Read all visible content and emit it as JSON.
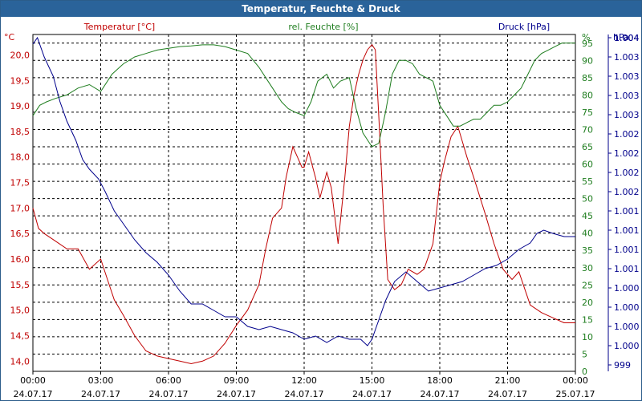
{
  "window": {
    "title": "Temperatur, Feuchte & Druck"
  },
  "colors": {
    "temperature": "#c00000",
    "humidity": "#1e7d1e",
    "pressure": "#00008b",
    "grid": "#000000",
    "title_bar": "#2a639a"
  },
  "chart_data": {
    "type": "line",
    "title": "Temperatur, Feuchte & Druck",
    "grid": true,
    "x": {
      "ticks": [
        {
          "time": "00:00",
          "date": "24.07.17"
        },
        {
          "time": "03:00",
          "date": "24.07.17"
        },
        {
          "time": "06:00",
          "date": "24.07.17"
        },
        {
          "time": "09:00",
          "date": "24.07.17"
        },
        {
          "time": "12:00",
          "date": "24.07.17"
        },
        {
          "time": "15:00",
          "date": "24.07.17"
        },
        {
          "time": "18:00",
          "date": "24.07.17"
        },
        {
          "time": "21:00",
          "date": "24.07.17"
        },
        {
          "time": "00:00",
          "date": "25.07.17"
        }
      ],
      "range_hours": [
        0,
        24
      ]
    },
    "axes": {
      "temperature": {
        "label": "Temperatur [°C]",
        "unit": "°C",
        "ylim": [
          13.8,
          20.4
        ],
        "ticks": [
          "14,0",
          "14,5",
          "15,0",
          "15,5",
          "16,0",
          "16,5",
          "17,0",
          "17,5",
          "18,0",
          "18,5",
          "19,0",
          "19,5",
          "20,0"
        ],
        "tick_values": [
          14.0,
          14.5,
          15.0,
          15.5,
          16.0,
          16.5,
          17.0,
          17.5,
          18.0,
          18.5,
          19.0,
          19.5,
          20.0
        ]
      },
      "humidity": {
        "label": "rel. Feuchte [%]",
        "unit": "%",
        "ylim": [
          0,
          97.5
        ],
        "ticks": [
          "0",
          "5",
          "10",
          "15",
          "20",
          "25",
          "30",
          "35",
          "40",
          "45",
          "50",
          "55",
          "60",
          "65",
          "70",
          "75",
          "80",
          "85",
          "90",
          "95"
        ],
        "tick_values": [
          0,
          5,
          10,
          15,
          20,
          25,
          30,
          35,
          40,
          45,
          50,
          55,
          60,
          65,
          70,
          75,
          80,
          85,
          90,
          95
        ]
      },
      "pressure": {
        "label": "Druck [hPa]",
        "unit": "hPa",
        "ylim": [
          998.9,
          1004.15
        ],
        "ticks": [
          "999",
          "1.000",
          "1.000",
          "1.000",
          "1.000",
          "1.001",
          "1.001",
          "1.001",
          "1.001",
          "1.002",
          "1.002",
          "1.002",
          "1.002",
          "1.003",
          "1.003",
          "1.003",
          "1.003",
          "1.004",
          "1.004"
        ],
        "tick_values": [
          999.0,
          999.3,
          999.6,
          999.9,
          1000.2,
          1000.5,
          1000.8,
          1001.1,
          1001.4,
          1001.7,
          1002.0,
          1002.3,
          1002.6,
          1002.9,
          1003.2,
          1003.5,
          1003.8,
          1004.1,
          1004.1
        ]
      }
    },
    "series": [
      {
        "name": "Temperatur [°C]",
        "axis": "temperature",
        "x": [
          0,
          0.25,
          0.5,
          1,
          1.5,
          2,
          2.5,
          3,
          3.3,
          3.6,
          4,
          4.5,
          5,
          5.5,
          6,
          6.5,
          7,
          7.5,
          8,
          8.5,
          9,
          9.5,
          10,
          10.3,
          10.6,
          11,
          11.2,
          11.5,
          11.7,
          11.9,
          12,
          12.2,
          12.5,
          12.7,
          13,
          13.2,
          13.5,
          13.8,
          14,
          14.2,
          14.4,
          14.6,
          14.8,
          15,
          15.15,
          15.3,
          15.5,
          15.7,
          16,
          16.3,
          16.6,
          17,
          17.3,
          17.7,
          18,
          18.2,
          18.5,
          18.8,
          19,
          19.2,
          19.5,
          20,
          20.4,
          20.8,
          21.2,
          21.5,
          22,
          22.5,
          23,
          23.5,
          24
        ],
        "values": [
          17.0,
          16.6,
          16.5,
          16.35,
          16.2,
          16.2,
          15.8,
          16.0,
          15.6,
          15.2,
          14.9,
          14.5,
          14.2,
          14.1,
          14.05,
          14.0,
          13.95,
          14.0,
          14.1,
          14.35,
          14.7,
          15.0,
          15.5,
          16.2,
          16.8,
          17.0,
          17.6,
          18.2,
          18.0,
          17.8,
          17.8,
          18.1,
          17.6,
          17.2,
          17.7,
          17.4,
          16.3,
          17.6,
          18.6,
          19.2,
          19.6,
          19.9,
          20.1,
          20.2,
          20.1,
          18.8,
          17.0,
          15.6,
          15.4,
          15.5,
          15.8,
          15.7,
          15.8,
          16.3,
          17.5,
          17.9,
          18.4,
          18.6,
          18.3,
          18.0,
          17.6,
          16.9,
          16.3,
          15.8,
          15.6,
          15.75,
          15.1,
          14.95,
          14.85,
          14.75,
          14.75
        ]
      },
      {
        "name": "rel. Feuchte [%]",
        "axis": "humidity",
        "x": [
          0,
          0.3,
          0.6,
          1,
          1.5,
          2,
          2.5,
          3,
          3.5,
          4,
          4.5,
          5,
          5.5,
          6,
          6.5,
          7,
          7.5,
          8,
          8.5,
          9,
          9.5,
          10,
          10.3,
          10.6,
          11,
          11.3,
          11.6,
          12,
          12.3,
          12.6,
          13,
          13.3,
          13.6,
          14,
          14.3,
          14.6,
          15,
          15.3,
          15.6,
          15.9,
          16.2,
          16.5,
          16.8,
          17.1,
          17.4,
          17.7,
          18,
          18.3,
          18.6,
          18.9,
          19.2,
          19.5,
          19.8,
          20.1,
          20.4,
          20.7,
          21,
          21.3,
          21.6,
          21.9,
          22.2,
          22.5,
          22.8,
          23.1,
          23.4,
          23.7,
          24
        ],
        "values": [
          74,
          77,
          78,
          79,
          80,
          82,
          83,
          81,
          86,
          89,
          91,
          92,
          93,
          93.5,
          94,
          94.2,
          94.5,
          94.5,
          94,
          93,
          92,
          88,
          85,
          82,
          78,
          76,
          75,
          74,
          78,
          84,
          86,
          82,
          84,
          85,
          76,
          69,
          65,
          66,
          75,
          86,
          90,
          90,
          89,
          86,
          85,
          84,
          77,
          74,
          71,
          71,
          72,
          73,
          73,
          75,
          77,
          77,
          78,
          80,
          82,
          86,
          90,
          92,
          93,
          94,
          95,
          95,
          95
        ]
      },
      {
        "name": "Druck [hPa]",
        "axis": "pressure",
        "x": [
          0,
          0.2,
          0.5,
          0.9,
          1.2,
          1.5,
          1.9,
          2.2,
          2.5,
          2.9,
          3.2,
          3.6,
          4,
          4.5,
          5,
          5.5,
          6,
          6.5,
          7,
          7.5,
          8,
          8.5,
          9,
          9.5,
          10,
          10.5,
          11,
          11.5,
          12,
          12.5,
          13,
          13.5,
          14,
          14.5,
          14.8,
          15,
          15.3,
          15.6,
          16,
          16.5,
          17,
          17.5,
          18,
          18.5,
          19,
          19.5,
          20,
          20.5,
          21,
          21.5,
          22,
          22.3,
          22.6,
          23,
          23.5,
          24
        ],
        "values": [
          1004.0,
          1004.1,
          1003.8,
          1003.5,
          1003.1,
          1002.8,
          1002.5,
          1002.2,
          1002.05,
          1001.9,
          1001.7,
          1001.4,
          1001.2,
          1000.95,
          1000.75,
          1000.6,
          1000.4,
          1000.15,
          999.95,
          999.95,
          999.85,
          999.75,
          999.75,
          999.6,
          999.55,
          999.6,
          999.55,
          999.5,
          999.4,
          999.45,
          999.35,
          999.45,
          999.4,
          999.4,
          999.3,
          999.4,
          999.7,
          1000.0,
          1000.3,
          1000.45,
          1000.3,
          1000.15,
          1000.2,
          1000.25,
          1000.3,
          1000.4,
          1000.5,
          1000.55,
          1000.65,
          1000.8,
          1000.9,
          1001.05,
          1001.1,
          1001.05,
          1001.0,
          1001.0
        ]
      }
    ]
  }
}
